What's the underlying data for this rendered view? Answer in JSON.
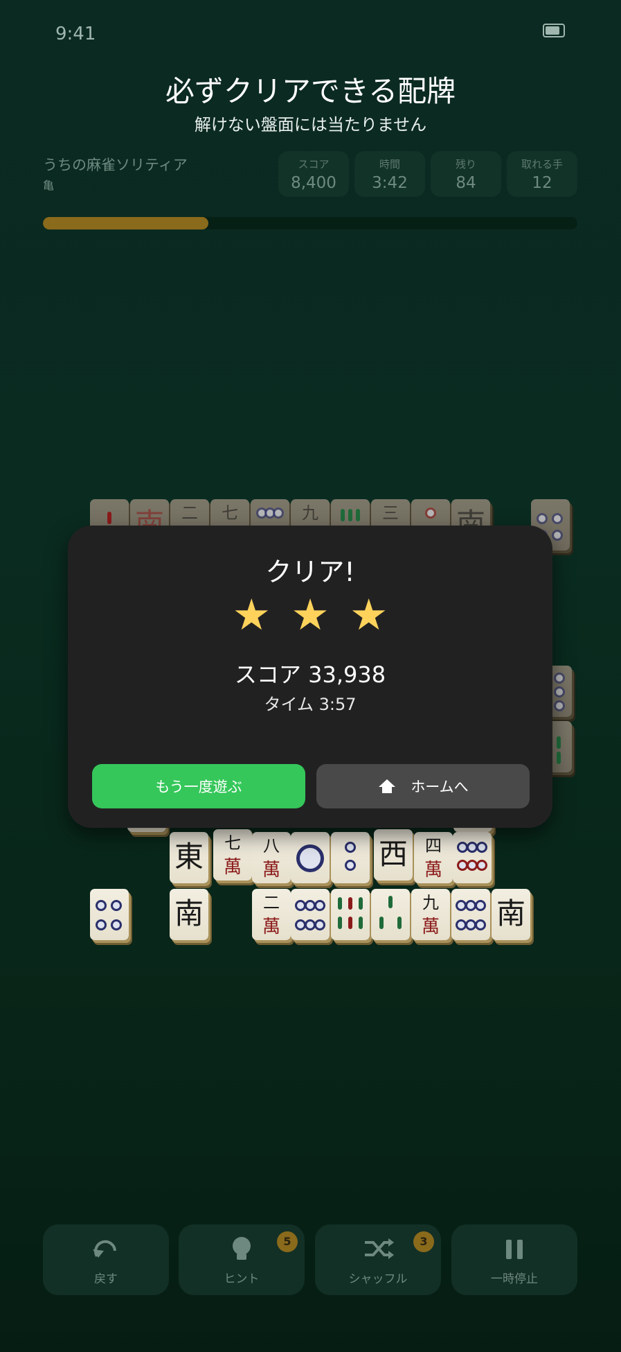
{
  "status": {
    "time": "9:41"
  },
  "hero": {
    "title": "必ずクリアできる配牌",
    "subtitle": "解けない盤面には当たりません"
  },
  "game": {
    "name": "うちの麻雀ソリティア",
    "layout": "亀"
  },
  "stats": [
    {
      "label": "スコア",
      "value": "8,400"
    },
    {
      "label": "時間",
      "value": "3:42"
    },
    {
      "label": "残り",
      "value": "84"
    },
    {
      "label": "取れる手",
      "value": "12"
    }
  ],
  "progress": {
    "fraction": 0.31
  },
  "tiles": {
    "east": "東",
    "south": "南",
    "west": "西",
    "man2": "二",
    "man4": "四",
    "man7": "七",
    "man8": "八",
    "man9": "九",
    "man3": "三",
    "wan": "萬"
  },
  "modal": {
    "title": "クリア!",
    "stars": [
      "★",
      "★",
      "★"
    ],
    "score_text": "スコア 33,938",
    "time_text": "タイム 3:57",
    "replay_label": "もう一度遊ぶ",
    "home_label": "ホームへ"
  },
  "toolbar": {
    "undo_label": "戻す",
    "hint_label": "ヒント",
    "hint_badge": "5",
    "shuffle_label": "シャッフル",
    "shuffle_badge": "3",
    "pause_label": "一時停止"
  },
  "colors": {
    "accent_green": "#35c75a",
    "gold": "#8a6a1b",
    "star": "#ffd35b"
  }
}
